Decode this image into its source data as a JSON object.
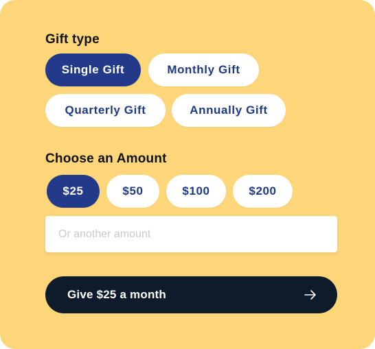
{
  "gift_type": {
    "label": "Gift type",
    "options": [
      "Single Gift",
      "Monthly Gift",
      "Quarterly Gift",
      "Annually Gift"
    ],
    "selected": "Single Gift"
  },
  "amount": {
    "label": "Choose an Amount",
    "options": [
      "$25",
      "$50",
      "$100",
      "$200"
    ],
    "selected": "$25",
    "custom_placeholder": "Or another amount",
    "custom_value": ""
  },
  "cta": {
    "label": "Give $25 a month",
    "icon": "arrow-right-icon"
  },
  "colors": {
    "background": "#FDD679",
    "selected_pill": "#223A89",
    "pill_text": "#1F3A84",
    "cta_background": "#0D1B2B"
  }
}
